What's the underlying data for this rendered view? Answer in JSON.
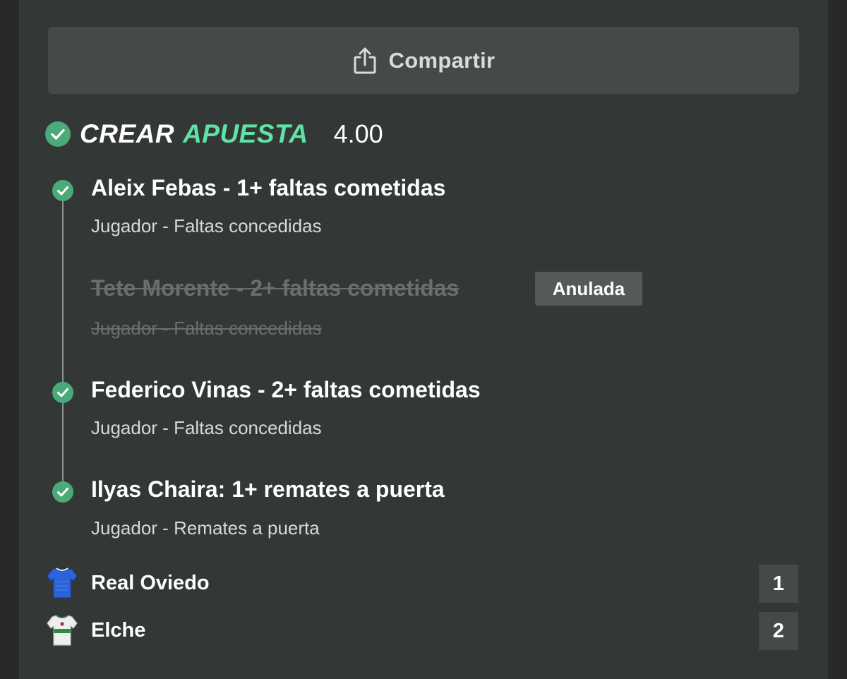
{
  "share": {
    "label": "Compartir",
    "icon": "share-icon"
  },
  "bet": {
    "title_part1": "CREAR",
    "title_part2": "APUESTA",
    "odds": "4.00",
    "accent_color": "#5fe2a5",
    "check_color": "#4caa79"
  },
  "legs": [
    {
      "title": "Aleix Febas - 1+ faltas cometidas",
      "subtitle": "Jugador - Faltas concedidas",
      "status": "won"
    },
    {
      "title": "Tete Morente - 2+ faltas cometidas",
      "subtitle": "Jugador - Faltas concedidas",
      "status": "void",
      "badge": "Anulada"
    },
    {
      "title": "Federico Vinas - 2+ faltas cometidas",
      "subtitle": "Jugador - Faltas concedidas",
      "status": "won"
    },
    {
      "title": "Ilyas Chaira: 1+ remates a puerta",
      "subtitle": "Jugador - Remates a puerta",
      "status": "won"
    }
  ],
  "teams": [
    {
      "name": "Real Oviedo",
      "score": "1",
      "kit": "blue-jersey-icon"
    },
    {
      "name": "Elche",
      "score": "2",
      "kit": "white-green-jersey-icon"
    }
  ]
}
